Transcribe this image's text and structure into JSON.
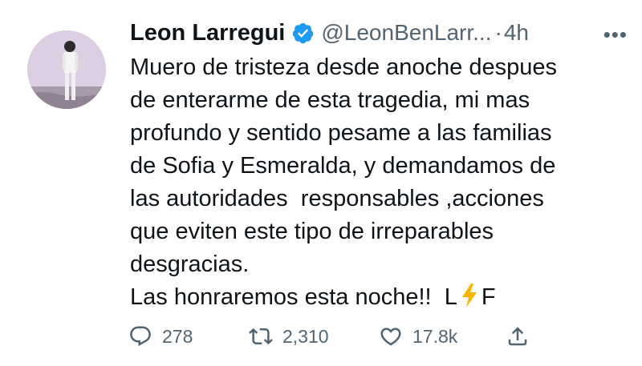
{
  "tweet": {
    "author_name": "Leon Larregui",
    "handle": "@LeonBenLarr...",
    "separator": "·",
    "timestamp": "4h",
    "more_menu": "•••",
    "lines": [
      "Muero de tristeza desde anoche despues",
      "de enterarme de esta tragedia, mi mas",
      "profundo y sentido pesame a las familias",
      "de Sofia y Esmeralda, y demandamos de",
      "las autoridades  responsables ,acciones",
      "que eviten este tipo de irreparables",
      "desgracias."
    ],
    "last_line_prefix": "Las honraremos esta noche!!  L",
    "last_line_suffix": "F",
    "accent_color": "#1d9bf0",
    "bolt_color": "#f7b500"
  },
  "actions": {
    "reply_count": "278",
    "retweet_count": "2,310",
    "like_count": "17.8k",
    "reply_icon": "reply-icon",
    "retweet_icon": "retweet-icon",
    "like_icon": "heart-icon",
    "share_icon": "share-icon"
  }
}
